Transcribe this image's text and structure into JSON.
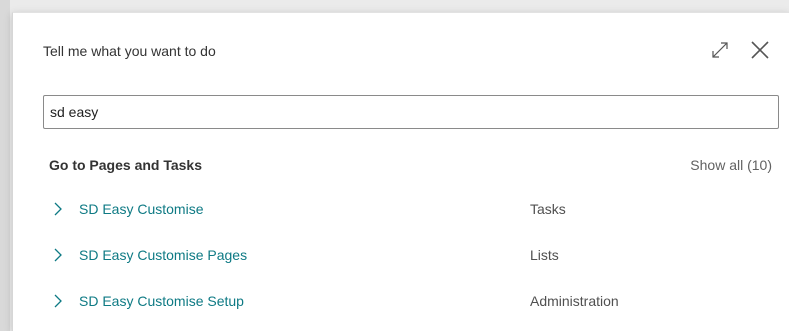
{
  "dialog": {
    "title": "Tell me what you want to do"
  },
  "search": {
    "value": "sd easy"
  },
  "results": {
    "heading": "Go to Pages and Tasks",
    "show_all": "Show all (10)",
    "items": [
      {
        "name": "SD Easy Customise",
        "category": "Tasks"
      },
      {
        "name": "SD Easy Customise Pages",
        "category": "Lists"
      },
      {
        "name": "SD Easy Customise Setup",
        "category": "Administration"
      }
    ]
  },
  "colors": {
    "link": "#0e7a84",
    "text": "#333333",
    "muted": "#616161"
  },
  "icons": {
    "expand": "expand-icon",
    "close": "close-icon",
    "chevron": "chevron-right-icon"
  }
}
